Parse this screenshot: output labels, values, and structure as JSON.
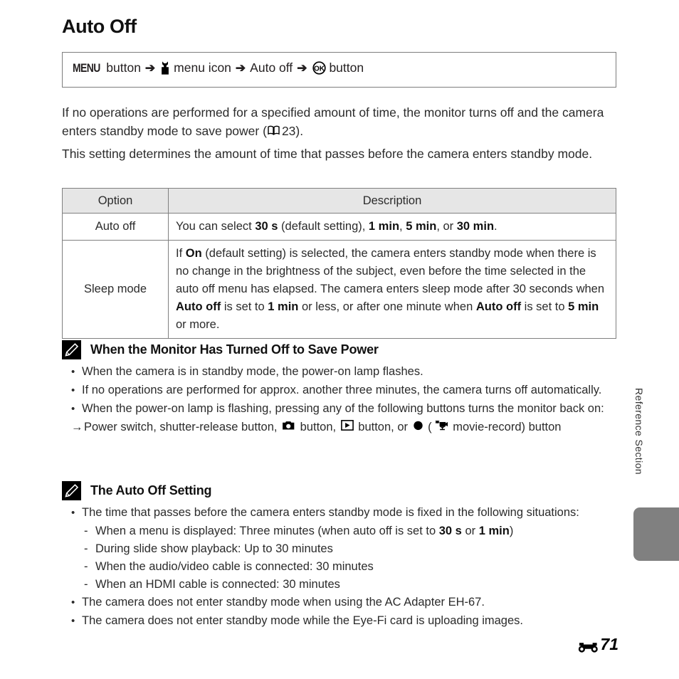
{
  "page": {
    "title": "Auto Off",
    "page_number": "71",
    "page_prefix_icon": "reference-section-e-icon",
    "side_tab_label": "Reference Section"
  },
  "nav_path": {
    "menu_label": "MENU",
    "menu_button_word": "button",
    "arrow": "➔",
    "setup_menu_icon": "wrench-icon",
    "menu_icon_label": "menu icon",
    "item_label": "Auto off",
    "ok_icon": "ok-button-icon",
    "ok_button_word": "button"
  },
  "intro": {
    "paragraph_1_a": "If no operations are performed for a specified amount of time, the monitor turns off and the camera enters standby mode to save power (",
    "paragraph_1_ref": "23",
    "paragraph_1_b": ").",
    "ref_icon": "book-icon",
    "paragraph_2": "This setting determines the amount of time that passes before the camera enters standby mode."
  },
  "table": {
    "headers": [
      "Option",
      "Description"
    ],
    "rows": [
      {
        "option": "Auto off",
        "desc_parts": [
          {
            "t": "You can select ",
            "b": false
          },
          {
            "t": "30 s",
            "b": true
          },
          {
            "t": " (default setting), ",
            "b": false
          },
          {
            "t": "1 min",
            "b": true
          },
          {
            "t": ", ",
            "b": false
          },
          {
            "t": "5 min",
            "b": true
          },
          {
            "t": ", or ",
            "b": false
          },
          {
            "t": "30 min",
            "b": true
          },
          {
            "t": ".",
            "b": false
          }
        ]
      },
      {
        "option": "Sleep mode",
        "desc_parts": [
          {
            "t": "If ",
            "b": false
          },
          {
            "t": "On",
            "b": true
          },
          {
            "t": " (default setting) is selected, the camera enters standby mode when there is no change in the brightness of the subject, even before the time selected in the auto off menu has elapsed. The camera enters sleep mode after 30 seconds when ",
            "b": false
          },
          {
            "t": "Auto off",
            "b": true
          },
          {
            "t": " is set to ",
            "b": false
          },
          {
            "t": "1 min",
            "b": true
          },
          {
            "t": " or less, or after one minute when ",
            "b": false
          },
          {
            "t": "Auto off",
            "b": true
          },
          {
            "t": " is set to ",
            "b": false
          },
          {
            "t": "5 min",
            "b": true
          },
          {
            "t": " or more.",
            "b": false
          }
        ]
      }
    ]
  },
  "note_1": {
    "icon": "pencil-note-icon",
    "heading": "When the Monitor Has Turned Off to Save Power",
    "bullets": [
      "When the camera is in standby mode, the power-on lamp flashes.",
      "If no operations are performed for approx. another three minutes, the camera turns off automatically.",
      "When the power-on lamp is flashing, pressing any of the following buttons turns the monitor back on:"
    ],
    "arrow_line": {
      "lead": "→",
      "part_1": "Power switch, shutter-release button, ",
      "camera_icon": "camera-icon",
      "part_2": " button, ",
      "playback_icon": "playback-icon",
      "part_3": " button, or ",
      "record_icon": "record-dot-icon",
      "part_4": " (",
      "movie_icon": "movie-camera-icon",
      "part_5": " movie-record) button"
    }
  },
  "note_2": {
    "icon": "pencil-note-icon",
    "heading": "The Auto Off Setting",
    "bullet_1": "The time that passes before the camera enters standby mode is fixed in the following situations:",
    "sub_items": [
      {
        "dash": "-",
        "parts": [
          {
            "t": "When a menu is displayed: Three minutes (when auto off is set to ",
            "b": false
          },
          {
            "t": "30 s",
            "b": true
          },
          {
            "t": " or ",
            "b": false
          },
          {
            "t": "1 min",
            "b": true
          },
          {
            "t": ")",
            "b": false
          }
        ]
      },
      {
        "dash": "-",
        "parts": [
          {
            "t": "During slide show playback: Up to 30 minutes",
            "b": false
          }
        ]
      },
      {
        "dash": "-",
        "parts": [
          {
            "t": "When the audio/video cable is connected: 30 minutes",
            "b": false
          }
        ]
      },
      {
        "dash": "-",
        "parts": [
          {
            "t": "When an HDMI cable is connected: 30 minutes",
            "b": false
          }
        ]
      }
    ],
    "bullets_tail": [
      "The camera does not enter standby mode when using the AC Adapter EH-67.",
      "The camera does not enter standby mode while the Eye-Fi card is uploading images."
    ]
  },
  "colors": {
    "table_header_bg": "#e6e6e6",
    "table_border": "#808080",
    "side_tab": "#808080",
    "text": "#2b2b2b"
  }
}
